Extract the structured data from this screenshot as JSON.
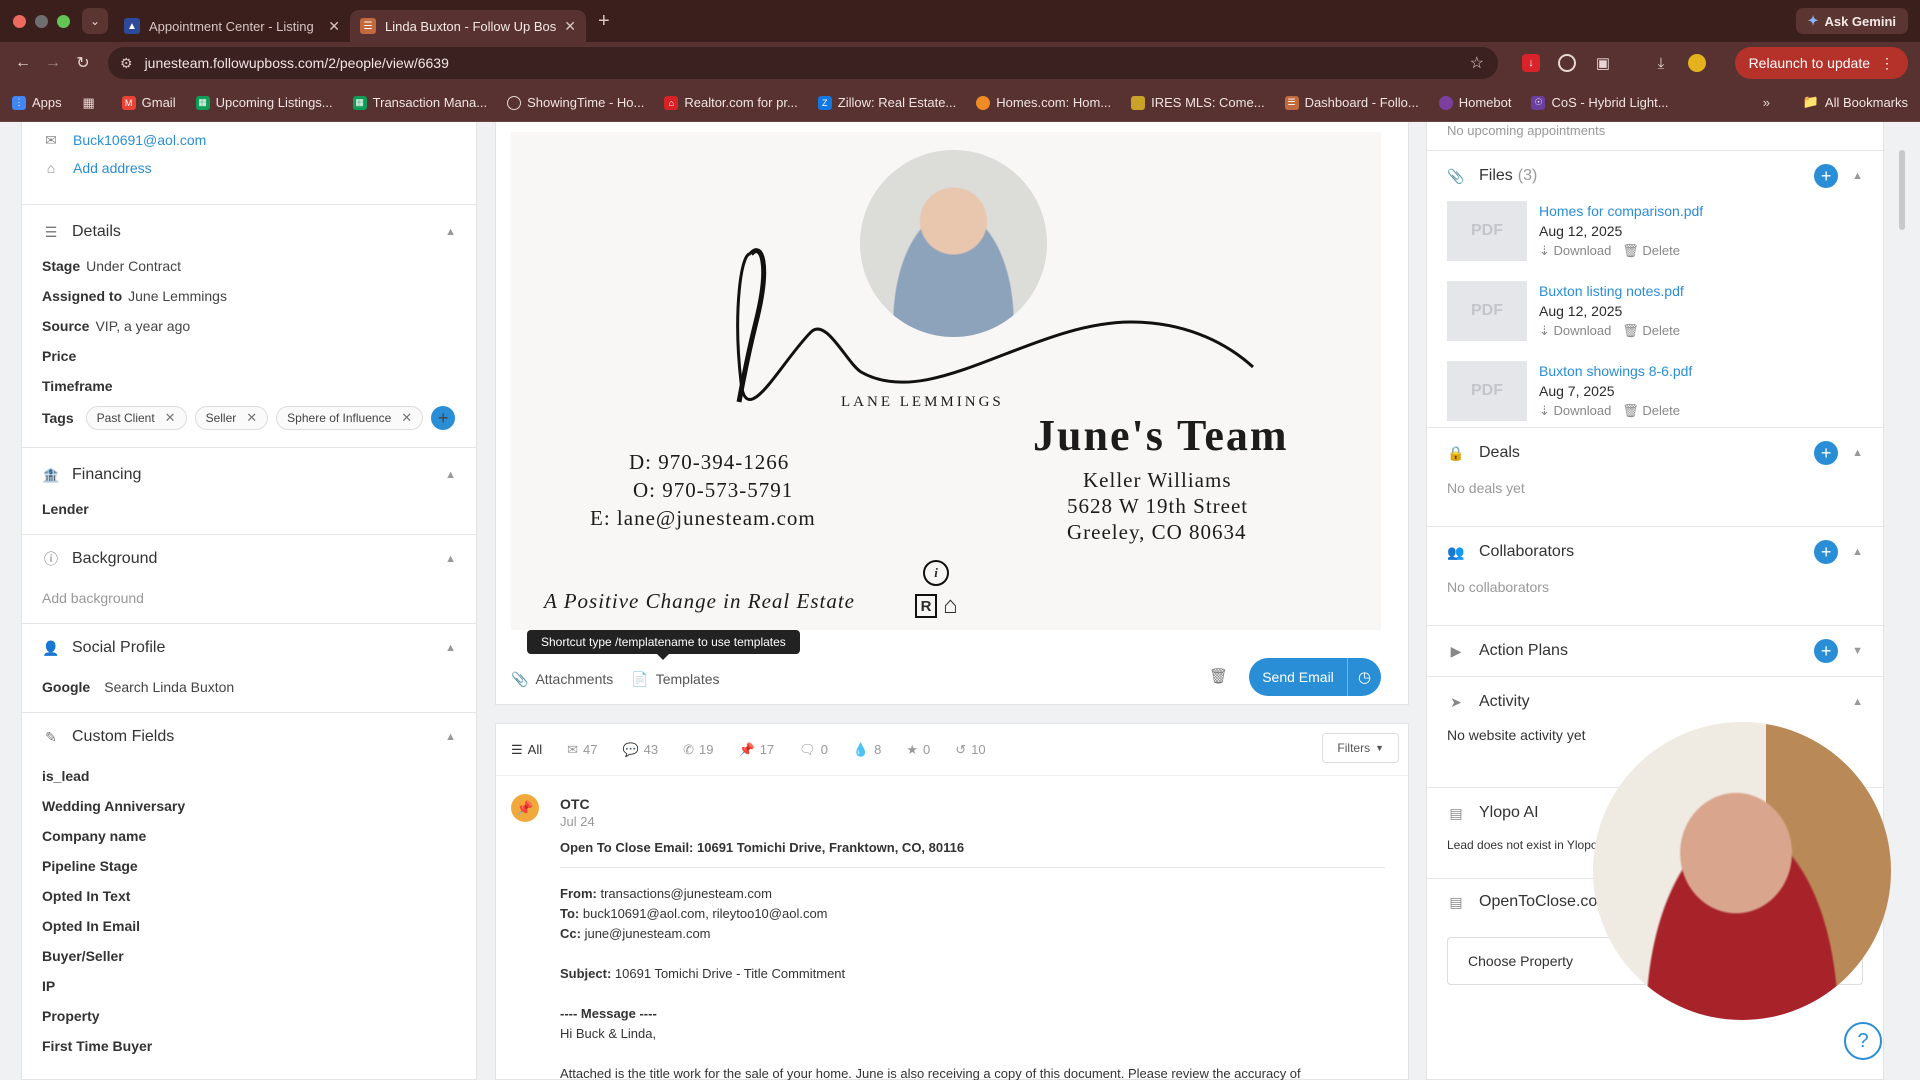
{
  "browser": {
    "tabs": [
      {
        "title": "Appointment Center - Listing",
        "active": false
      },
      {
        "title": "Linda Buxton - Follow Up Bos",
        "active": true
      }
    ],
    "ask_gemini": "Ask Gemini",
    "url": "junesteam.followupboss.com/2/people/view/6639",
    "relaunch": "Relaunch to update",
    "bookmarks": [
      "Apps",
      "Gmail",
      "Upcoming Listings...",
      "Transaction Mana...",
      "ShowingTime - Ho...",
      "Realtor.com for pr...",
      "Zillow: Real Estate...",
      "Homes.com: Hom...",
      "IRES MLS: Come...",
      "Dashboard - Follo...",
      "Homebot",
      "CoS - Hybrid Light..."
    ],
    "all_bookmarks": "All Bookmarks"
  },
  "left": {
    "email": "Buck10691@aol.com",
    "add_address": "Add address",
    "details": {
      "title": "Details",
      "fields": [
        {
          "label": "Stage",
          "value": "Under Contract"
        },
        {
          "label": "Assigned to",
          "value": "June Lemmings"
        },
        {
          "label": "Source",
          "value": "VIP, a year ago"
        },
        {
          "label": "Price",
          "value": ""
        },
        {
          "label": "Timeframe",
          "value": ""
        }
      ],
      "tags_label": "Tags",
      "tags": [
        "Past Client",
        "Seller",
        "Sphere of Influence"
      ]
    },
    "financing": {
      "title": "Financing",
      "lender": "Lender"
    },
    "background": {
      "title": "Background",
      "add": "Add background"
    },
    "social": {
      "title": "Social Profile",
      "label": "Google",
      "link": "Search Linda Buxton"
    },
    "custom": {
      "title": "Custom Fields",
      "fields": [
        "is_lead",
        "Wedding Anniversary",
        "Company name",
        "Pipeline Stage",
        "Opted In Text",
        "Opted In Email",
        "Buyer/Seller",
        "IP",
        "Property",
        "First Time Buyer"
      ]
    }
  },
  "signature": {
    "name": "LANE LEMMINGS",
    "team": "June's Team",
    "direct": "D: 970-394-1266",
    "office": "O: 970-573-5791",
    "email": "E: lane@junesteam.com",
    "brokerage": "Keller Williams",
    "street": "5628 W 19th Street",
    "city": "Greeley, CO 80634",
    "tagline": "A Positive Change in Real Estate"
  },
  "compose": {
    "tooltip": "Shortcut type /templatename to use templates",
    "attachments": "Attachments",
    "templates": "Templates",
    "send": "Send Email"
  },
  "timeline": {
    "tabs": [
      {
        "icon": "list-icon",
        "label": "All"
      },
      {
        "icon": "email-icon",
        "label": "47"
      },
      {
        "icon": "chat-icon",
        "label": "43"
      },
      {
        "icon": "phone-icon",
        "label": "19"
      },
      {
        "icon": "pin-icon",
        "label": "17"
      },
      {
        "icon": "message-icon",
        "label": "0"
      },
      {
        "icon": "drop-icon",
        "label": "8"
      },
      {
        "icon": "star-icon",
        "label": "0"
      },
      {
        "icon": "history-icon",
        "label": "10"
      }
    ],
    "filters": "Filters",
    "entry": {
      "title": "OTC",
      "date": "Jul 24",
      "subject_line": "Open To Close Email: 10691 Tomichi Drive, Franktown, CO, 80116",
      "from_label": "From:",
      "from": "transactions@junesteam.com",
      "to_label": "To:",
      "to": "buck10691@aol.com, rileytoo10@aol.com",
      "cc_label": "Cc:",
      "cc": "june@junesteam.com",
      "subject_label": "Subject:",
      "subject": "10691 Tomichi Drive - Title Commitment",
      "message_label": "---- Message ----",
      "greeting": "Hi Buck & Linda,",
      "body": "Attached is the title work for the sale of your home. June is also receiving a copy of this document. Please review the accuracy of"
    }
  },
  "right": {
    "no_appointments": "No upcoming appointments",
    "files_title": "Files",
    "files_count": "(3)",
    "files": [
      {
        "name": "Homes for comparison.pdf",
        "date": "Aug 12, 2025"
      },
      {
        "name": "Buxton listing notes.pdf",
        "date": "Aug 12, 2025"
      },
      {
        "name": "Buxton showings 8-6.pdf",
        "date": "Aug 7, 2025"
      }
    ],
    "pdf": "PDF",
    "download": "Download",
    "delete": "Delete",
    "deals": {
      "title": "Deals",
      "empty": "No deals yet"
    },
    "collaborators": {
      "title": "Collaborators",
      "empty": "No collaborators"
    },
    "action_plans": "Action Plans",
    "activity": {
      "title": "Activity",
      "empty": "No website activity yet"
    },
    "ylopo": {
      "title": "Ylopo AI",
      "text": "Lead does not exist in Ylopo"
    },
    "otc": {
      "title": "OpenToClose.com",
      "choose": "Choose Property"
    }
  },
  "colors": {
    "accent": "#2a8ed6",
    "chrome": "#573230",
    "relaunch": "#b4322a",
    "pin": "#f2a93b"
  }
}
